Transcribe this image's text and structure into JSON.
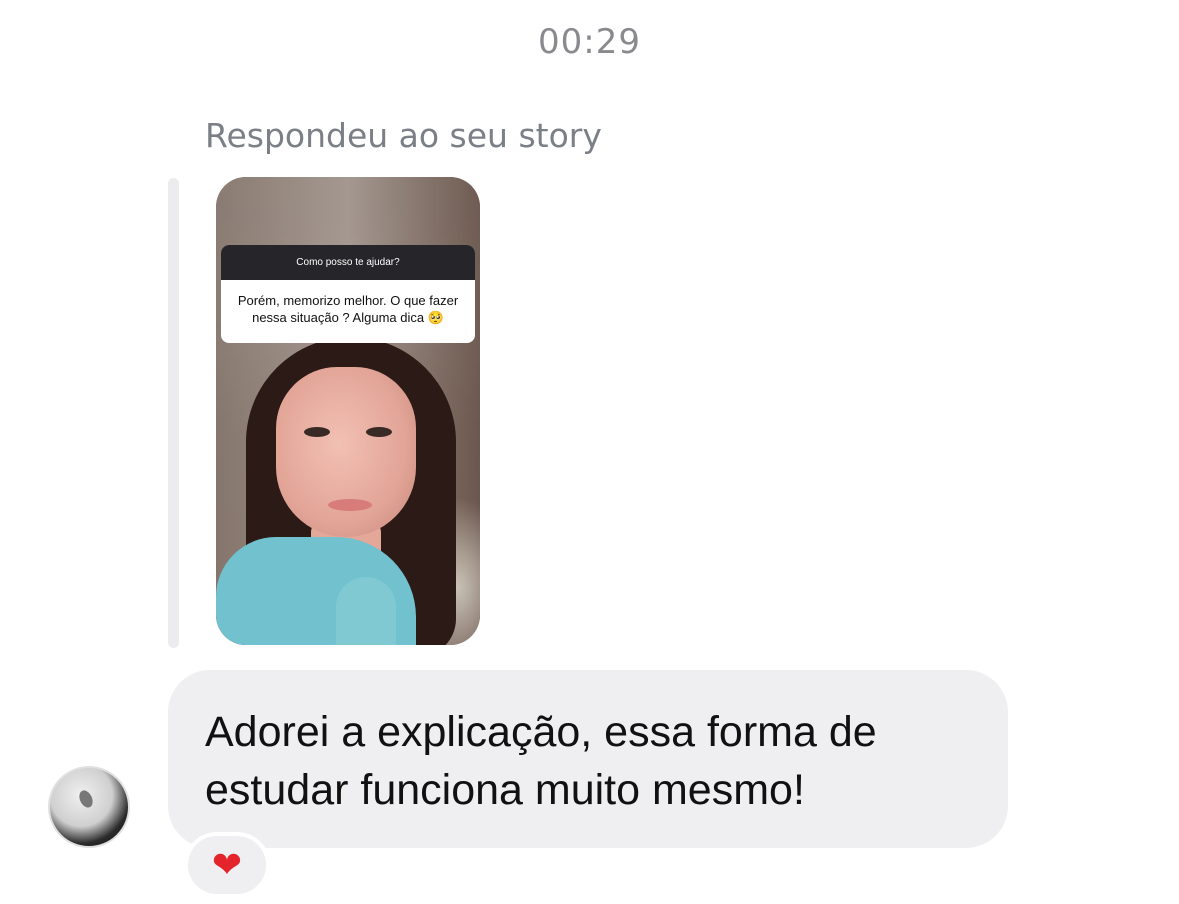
{
  "chat": {
    "timestamp": "00:29",
    "reply_caption": "Respondeu ao seu story",
    "story": {
      "question": "Como posso te ajudar?",
      "answer_line1": "Porém, memorizo melhor. O que fazer",
      "answer_line2": "nessa situação ? Alguma dica 🥺"
    },
    "message": {
      "line1": "Adorei a explicação, essa forma de",
      "line2": "estudar funciona muito mesmo!"
    },
    "reaction": "❤"
  },
  "colors": {
    "bubble": "#efeff2",
    "timestamp": "#8a8a8e",
    "heart": "#e3242b"
  }
}
